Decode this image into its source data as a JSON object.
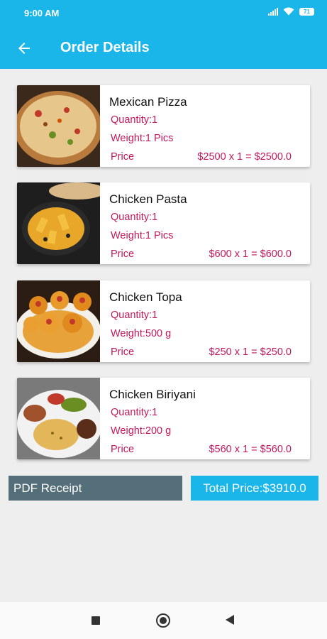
{
  "status_bar": {
    "time": "9:00 AM",
    "battery": "71"
  },
  "header": {
    "title": "Order Details",
    "back_icon": "arrow-left-icon"
  },
  "items": [
    {
      "name": "Mexican Pizza",
      "quantity": "Quantity:1",
      "weight": "Weight:1 Pics",
      "price_label": "Price",
      "price_calc": "$2500 x 1 = $2500.0",
      "image": "pizza-photo"
    },
    {
      "name": "Chicken Pasta",
      "quantity": "Quantity:1",
      "weight": "Weight:1 Pics",
      "price_label": "Price",
      "price_calc": "$600 x 1 = $600.0",
      "image": "pasta-photo"
    },
    {
      "name": "Chicken Topa",
      "quantity": "Quantity:1",
      "weight": "Weight:500 g",
      "price_label": "Price",
      "price_calc": "$250 x 1 = $250.0",
      "image": "topa-photo"
    },
    {
      "name": "Chicken Biriyani",
      "quantity": "Quantity:1",
      "weight": "Weight:200 g",
      "price_label": "Price",
      "price_calc": "$560 x 1 = $560.0",
      "image": "biriyani-photo"
    }
  ],
  "footer": {
    "pdf_label": "PDF Receipt",
    "total_label": "Total Price:$3910.0"
  },
  "colors": {
    "primary": "#1ab6ea",
    "accent_text": "#c2185b",
    "pdf_button": "#546e7a"
  }
}
